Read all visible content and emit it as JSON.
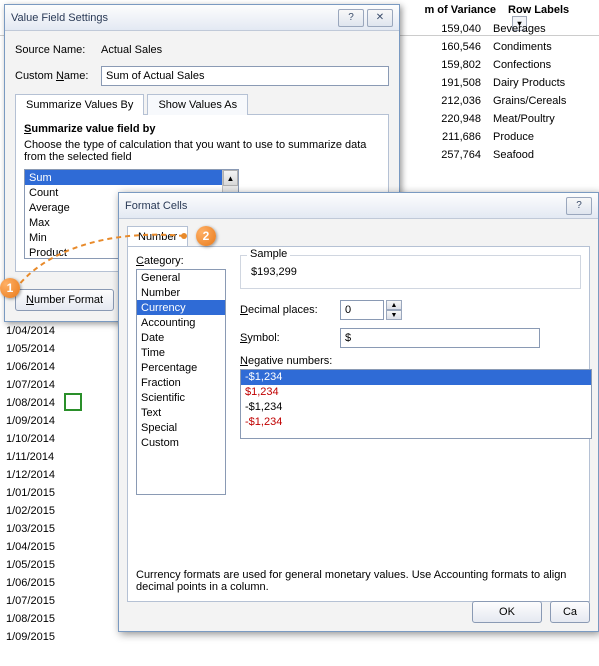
{
  "bg": {
    "col_variance": "m of Variance",
    "col_rowlabels": "Row Labels",
    "rows": [
      {
        "v": "159,040",
        "l": "Beverages"
      },
      {
        "v": "160,546",
        "l": "Condiments"
      },
      {
        "v": "159,802",
        "l": "Confections"
      },
      {
        "v": "191,508",
        "l": "Dairy Products"
      },
      {
        "v": "212,036",
        "l": "Grains/Cereals"
      },
      {
        "v": "220,948",
        "l": "Meat/Poultry"
      },
      {
        "v": "211,686",
        "l": "Produce"
      },
      {
        "v": "257,764",
        "l": "Seafood"
      }
    ],
    "dates": [
      "1/04/2014",
      "1/05/2014",
      "1/06/2014",
      "1/07/2014",
      "1/08/2014",
      "1/09/2014",
      "1/10/2014",
      "1/11/2014",
      "1/12/2014",
      "1/01/2015",
      "1/02/2015",
      "1/03/2015",
      "1/04/2015",
      "1/05/2015",
      "1/06/2015",
      "1/07/2015",
      "1/08/2015",
      "1/09/2015"
    ]
  },
  "dlg1": {
    "title": "Value Field Settings",
    "source_label": "Source Name:",
    "source_val": "Actual Sales",
    "custom_label_pre": "Custom ",
    "custom_label_u": "N",
    "custom_label_post": "ame:",
    "custom_val": "Sum of Actual Sales",
    "tab1": "Summarize Values By",
    "tab2": "Show Values As",
    "section_header_u": "S",
    "section_header": "ummarize value field by",
    "section_desc": "Choose the type of calculation that you want to use to summarize data from the selected field",
    "list": [
      "Sum",
      "Count",
      "Average",
      "Max",
      "Min",
      "Product"
    ],
    "number_fmt_u": "N",
    "number_fmt": "umber Format"
  },
  "dlg2": {
    "title": "Format Cells",
    "tab": "Number",
    "cat_label_u": "C",
    "cat_label": "ategory:",
    "categories": [
      "General",
      "Number",
      "Currency",
      "Accounting",
      "Date",
      "Time",
      "Percentage",
      "Fraction",
      "Scientific",
      "Text",
      "Special",
      "Custom"
    ],
    "sample_label": "Sample",
    "sample_val": "$193,299",
    "dec_label_u": "D",
    "dec_label": "ecimal places:",
    "dec_val": "0",
    "sym_label_u": "S",
    "sym_label": "ymbol:",
    "sym_val": "$",
    "neg_label_u": "N",
    "neg_label": "egative numbers:",
    "neg": [
      "-$1,234",
      "$1,234",
      "-$1,234",
      "-$1,234"
    ],
    "desc": "Currency formats are used for general monetary values.  Use Accounting formats to align decimal points in a column.",
    "ok": "OK",
    "cancel": "Ca"
  },
  "callouts": {
    "c1": "1",
    "c2": "2"
  }
}
